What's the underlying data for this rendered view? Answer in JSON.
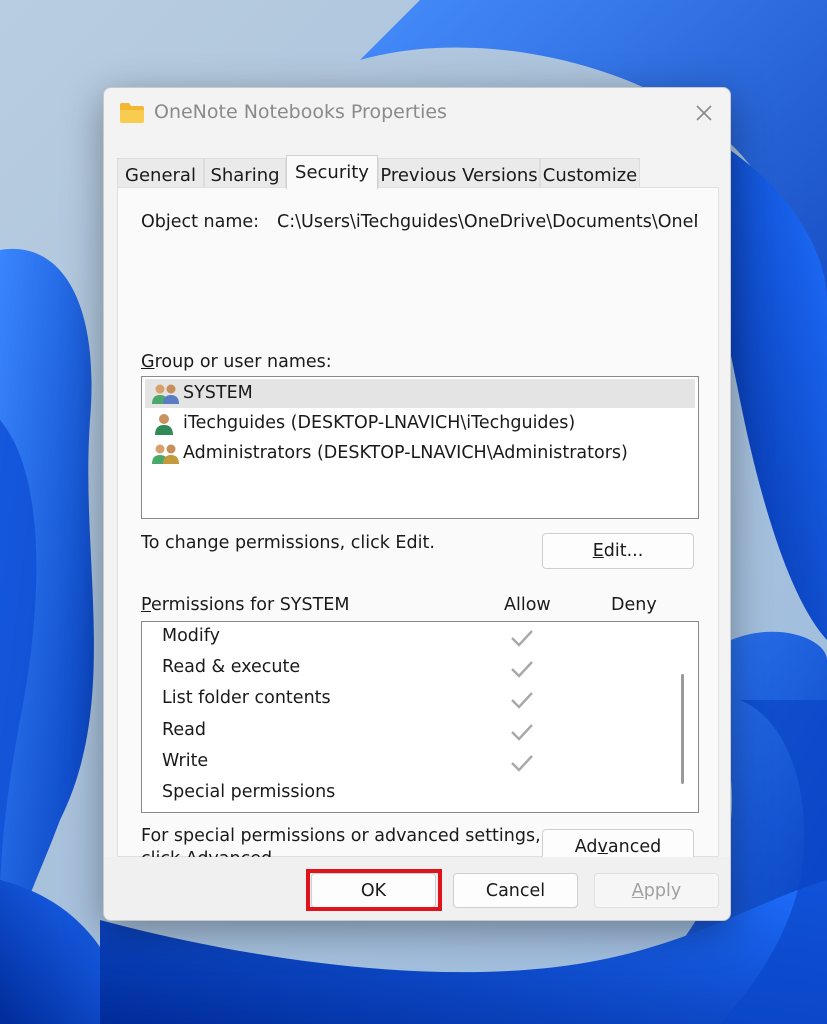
{
  "window": {
    "title": "OneNote Notebooks Properties"
  },
  "tabs": [
    {
      "label": "General"
    },
    {
      "label": "Sharing"
    },
    {
      "label": "Security",
      "active": true
    },
    {
      "label": "Previous Versions"
    },
    {
      "label": "Customize"
    }
  ],
  "object": {
    "label": "Object name:",
    "value": "C:\\Users\\iTechguides\\OneDrive\\Documents\\OneNote Notebooks"
  },
  "group_users": {
    "label": "Group or user names:",
    "items": [
      {
        "label": "SYSTEM",
        "icon": "user-group-icon",
        "selected": true
      },
      {
        "label": "iTechguides (DESKTOP-LNAVICH\\iTechguides)",
        "icon": "user-icon"
      },
      {
        "label": "Administrators (DESKTOP-LNAVICH\\Administrators)",
        "icon": "user-group-icon"
      }
    ]
  },
  "change_hint": "To change permissions, click Edit.",
  "edit_button": {
    "label": "Edit..."
  },
  "permissions": {
    "label": "Permissions for SYSTEM",
    "allow_header": "Allow",
    "deny_header": "Deny",
    "rows": [
      {
        "name": "Modify",
        "allow": true
      },
      {
        "name": "Read & execute",
        "allow": true
      },
      {
        "name": "List folder contents",
        "allow": true
      },
      {
        "name": "Read",
        "allow": true
      },
      {
        "name": "Write",
        "allow": true
      },
      {
        "name": "Special permissions",
        "allow": false
      }
    ]
  },
  "advanced_hint": {
    "line1": "For special permissions or advanced settings,",
    "line2": "click Advanced."
  },
  "advanced_button": {
    "label": "Advanced"
  },
  "footer": {
    "ok": "OK",
    "cancel": "Cancel",
    "apply": "Apply"
  },
  "colors": {
    "highlight": "#e0121b",
    "wallpaper_blue": "#0a55d8"
  }
}
